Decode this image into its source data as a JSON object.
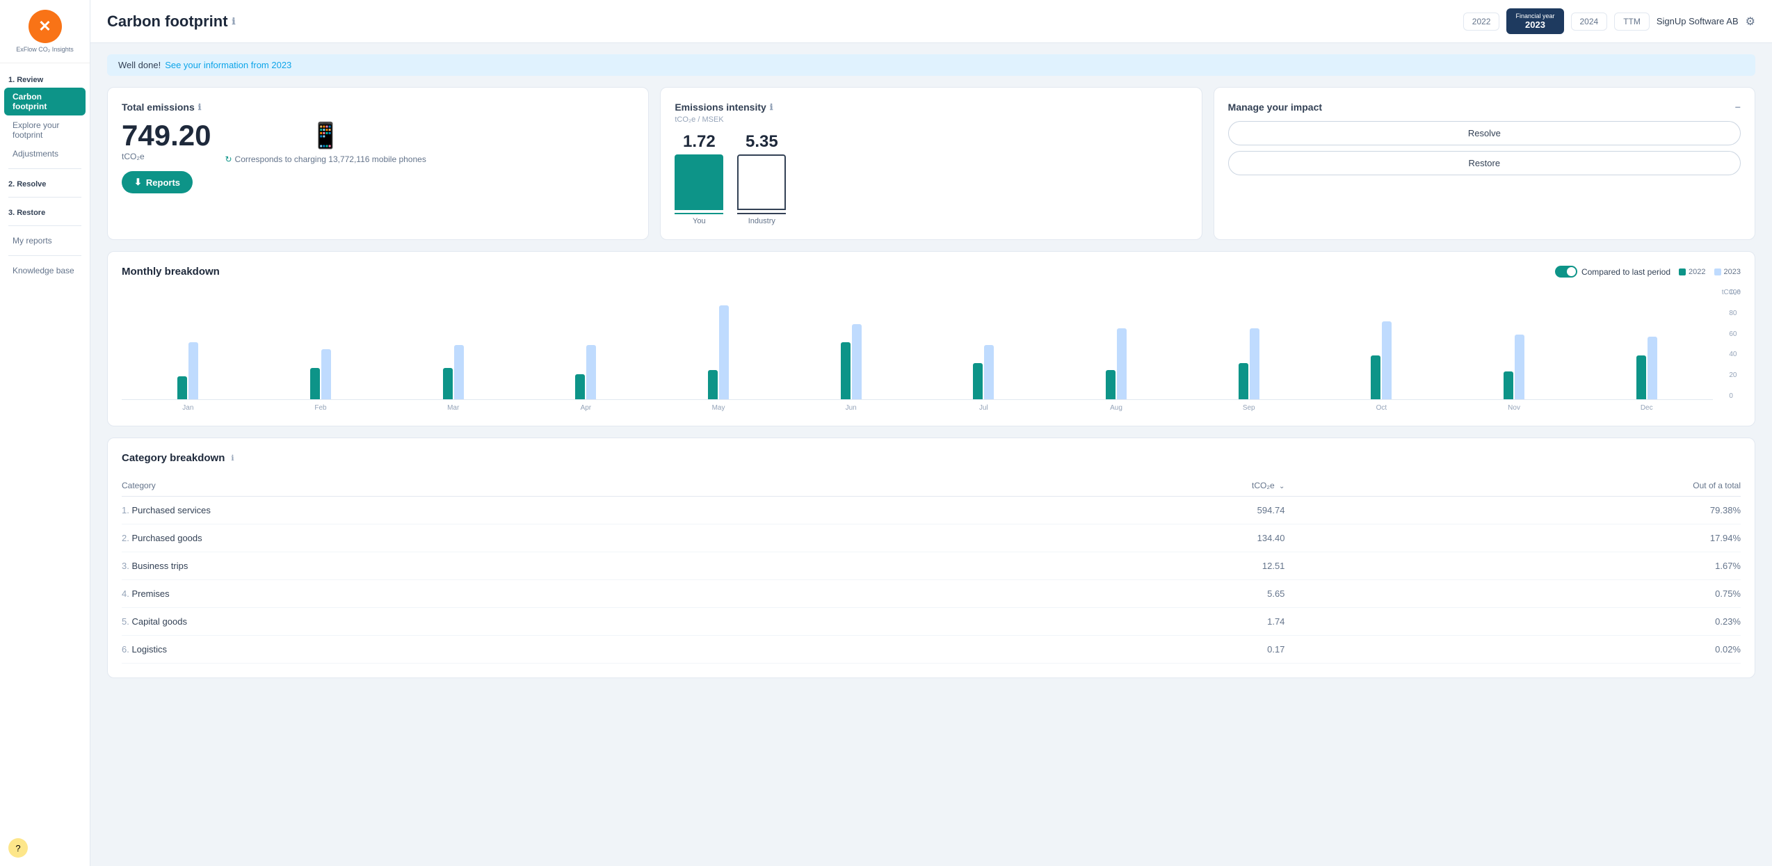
{
  "sidebar": {
    "logo": "✕",
    "logo_text": "ExFlow CO₂ Insights",
    "nav": {
      "section1": "1. Review",
      "items1": [
        {
          "label": "Carbon footprint",
          "active": true
        },
        {
          "label": "Explore your footprint",
          "active": false
        },
        {
          "label": "Adjustments",
          "active": false
        }
      ],
      "section2": "2. Resolve",
      "section3": "3. Restore",
      "items2": [
        "My reports"
      ],
      "items3": [
        "Knowledge base"
      ]
    }
  },
  "header": {
    "title": "Carbon footprint",
    "years": [
      "2022",
      "Financial year\n2023",
      "2024",
      "TTM"
    ],
    "active_year": "Financial year\n2023",
    "active_year_label": "Financial year",
    "active_year_val": "2023",
    "company": "SignUp Software AB"
  },
  "alert": {
    "prefix": "Well done!",
    "link_text": "See your information from 2023"
  },
  "total_emissions": {
    "title": "Total emissions",
    "value": "749.20",
    "unit": "tCO₂e",
    "corresponds": "Corresponds to charging 13,772,116 mobile phones",
    "reports_btn": "Reports"
  },
  "emissions_intensity": {
    "title": "Emissions intensity",
    "subtitle": "tCO₂e / MSEK",
    "you_value": "1.72",
    "you_label": "You",
    "industry_value": "5.35",
    "industry_label": "Industry"
  },
  "manage": {
    "title": "Manage your impact",
    "resolve_btn": "Resolve",
    "restore_btn": "Restore"
  },
  "monthly_breakdown": {
    "title": "Monthly breakdown",
    "toggle_label": "Compared to last period",
    "legend_2022": "2022",
    "legend_2023": "2023",
    "y_label": "tCO₂e",
    "y_ticks": [
      "100",
      "80",
      "60",
      "40",
      "20",
      "0"
    ],
    "months": [
      "Jan",
      "Feb",
      "Mar",
      "Apr",
      "May",
      "Jun",
      "Jul",
      "Aug",
      "Sep",
      "Oct",
      "Nov",
      "Dec"
    ],
    "data_2022": [
      22,
      30,
      30,
      24,
      28,
      55,
      35,
      28,
      35,
      42,
      27,
      42
    ],
    "data_2023": [
      55,
      48,
      52,
      52,
      90,
      72,
      52,
      68,
      68,
      75,
      62,
      60
    ]
  },
  "category_breakdown": {
    "title": "Category breakdown",
    "col_category": "Category",
    "col_tco2e": "tCO₂e",
    "col_total": "Out of a total",
    "rows": [
      {
        "rank": "1.",
        "name": "Purchased services",
        "value": "594.74",
        "pct": "79.38%"
      },
      {
        "rank": "2.",
        "name": "Purchased goods",
        "value": "134.40",
        "pct": "17.94%"
      },
      {
        "rank": "3.",
        "name": "Business trips",
        "value": "12.51",
        "pct": "1.67%"
      },
      {
        "rank": "4.",
        "name": "Premises",
        "value": "5.65",
        "pct": "0.75%"
      },
      {
        "rank": "5.",
        "name": "Capital goods",
        "value": "1.74",
        "pct": "0.23%"
      },
      {
        "rank": "6.",
        "name": "Logistics",
        "value": "0.17",
        "pct": "0.02%"
      }
    ]
  },
  "colors": {
    "teal": "#0d9488",
    "navy": "#1e3a5f",
    "bar_2022": "#0d9488",
    "bar_2023": "#bfdbfe"
  }
}
